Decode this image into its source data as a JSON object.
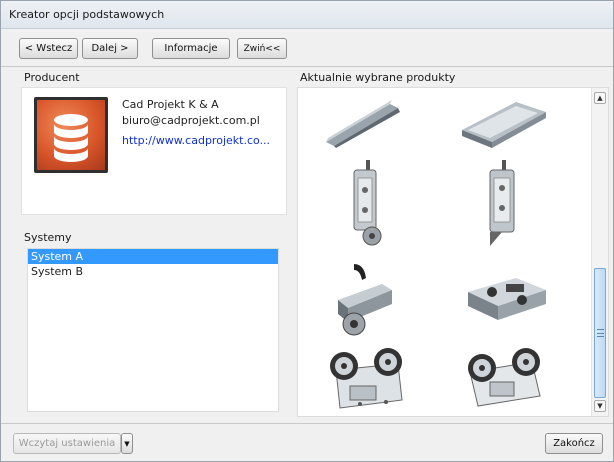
{
  "window": {
    "title": "Kreator opcji podstawowych"
  },
  "toolbar": {
    "back_label": "< Wstecz",
    "next_label": "Dalej >",
    "info_label": "Informacje",
    "collapse_label": "Zwiń<<"
  },
  "producer": {
    "heading": "Producent",
    "name": "Cad Projekt K & A",
    "email": "biuro@cadprojekt.com.pl",
    "url": "http://www.cadprojekt.co...",
    "logo_icon": "database-icon"
  },
  "systems": {
    "heading": "Systemy",
    "items": [
      {
        "label": "System A",
        "selected": true
      },
      {
        "label": "System B",
        "selected": false
      }
    ]
  },
  "products": {
    "heading": "Aktualnie wybrane produkty",
    "items": [
      {
        "icon": "rail-profile-icon"
      },
      {
        "icon": "rail-profile-wide-icon"
      },
      {
        "icon": "door-hanger-icon"
      },
      {
        "icon": "door-hanger-alt-icon"
      },
      {
        "icon": "roller-bracket-icon"
      },
      {
        "icon": "roller-carriage-icon"
      },
      {
        "icon": "twin-wheel-trolley-icon"
      },
      {
        "icon": "twin-wheel-trolley-alt-icon"
      }
    ]
  },
  "footer": {
    "load_settings_label": "Wczytaj ustawienia",
    "finish_label": "Zakończ"
  },
  "colors": {
    "selection": "#3399ff",
    "link": "#1030d0",
    "logo_orange": "#d9562a"
  }
}
